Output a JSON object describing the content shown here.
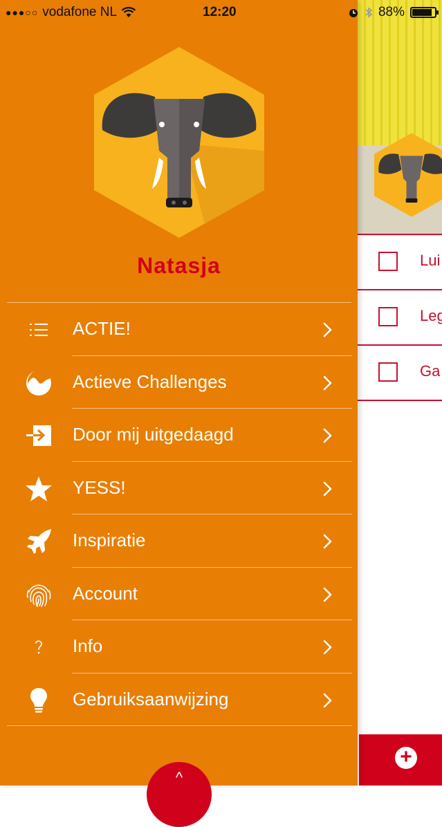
{
  "status_bar": {
    "carrier": "vodafone NL",
    "signal_dots": "●●●○○",
    "time": "12:20",
    "battery_percent": "88%",
    "battery_level": 0.88
  },
  "drawer": {
    "username": "Natasja",
    "menu": [
      {
        "label": "ACTIE!",
        "icon": "list-icon"
      },
      {
        "label": "Actieve Challenges",
        "icon": "wave-circle-icon"
      },
      {
        "label": "Door mij uitgedaagd",
        "icon": "arrow-into-box-icon"
      },
      {
        "label": "YESS!",
        "icon": "star-icon"
      },
      {
        "label": "Inspiratie",
        "icon": "jet-icon"
      },
      {
        "label": "Account",
        "icon": "fingerprint-icon"
      },
      {
        "label": "Info",
        "icon": "question-icon"
      },
      {
        "label": "Gebruiksaanwijzing",
        "icon": "lightbulb-icon"
      }
    ]
  },
  "background_screen": {
    "rows": [
      {
        "label": "Lui"
      },
      {
        "label": "Leg"
      },
      {
        "label": "Ga"
      }
    ]
  },
  "colors": {
    "drawer_bg": "#e87e04",
    "accent_red": "#d0021b",
    "hex_yellow": "#f7b21e"
  }
}
